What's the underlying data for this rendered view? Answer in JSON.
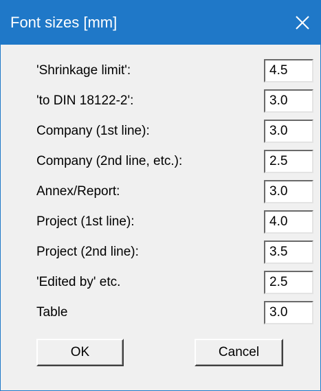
{
  "dialog": {
    "title": "Font sizes [mm]",
    "close_icon": "close-icon"
  },
  "fields": [
    {
      "label": "'Shrinkage limit':",
      "value": "4.5"
    },
    {
      "label": "'to DIN 18122-2':",
      "value": "3.0"
    },
    {
      "label": "Company (1st line):",
      "value": "3.0"
    },
    {
      "label": "Company (2nd line, etc.):",
      "value": "2.5"
    },
    {
      "label": "Annex/Report:",
      "value": "3.0"
    },
    {
      "label": "Project (1st line):",
      "value": "4.0"
    },
    {
      "label": "Project (2nd line):",
      "value": "3.5"
    },
    {
      "label": "'Edited by' etc.",
      "value": "2.5"
    },
    {
      "label": "Table",
      "value": "3.0"
    }
  ],
  "buttons": {
    "ok_label": "OK",
    "cancel_label": "Cancel"
  },
  "colors": {
    "titlebar": "#1f78c8",
    "background": "#f0f0f0"
  }
}
